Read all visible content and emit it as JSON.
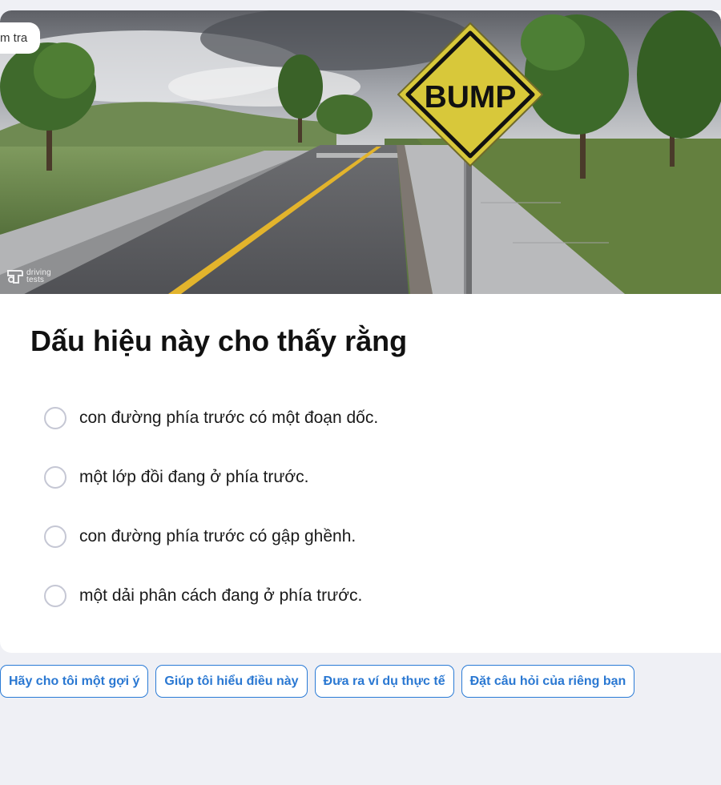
{
  "tab_label": "m tra",
  "image": {
    "sign_text": "BUMP",
    "watermark_line1": "driving",
    "watermark_line2": "tests",
    "sign_color": "#d8c83a"
  },
  "question": "Dấu hiệu này cho thấy rằng",
  "options": [
    "con đường phía trước có một đoạn dốc.",
    "một lớp đồi đang ở phía trước.",
    "con đường phía trước có gập ghềnh.",
    "một dải phân cách đang ở phía trước."
  ],
  "suggestions": [
    "Hãy cho tôi một gợi ý",
    "Giúp tôi hiểu điều này",
    "Đưa ra ví dụ thực tế",
    "Đặt câu hỏi của riêng bạn"
  ],
  "colors": {
    "accent": "#2a7bd6",
    "background": "#eff0f5",
    "radio_border": "#c5c7d4"
  }
}
